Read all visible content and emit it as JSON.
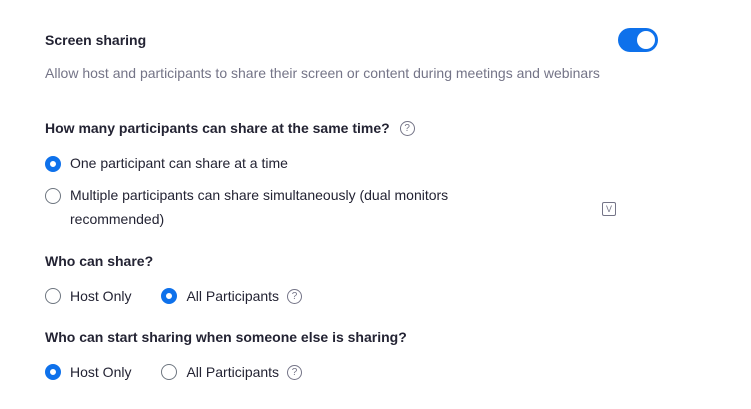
{
  "setting": {
    "title": "Screen sharing",
    "description": "Allow host and participants to share their screen or content during meetings and webinars",
    "enabled": true,
    "toggle_color": "#0e71eb"
  },
  "share_count": {
    "question": "How many participants can share at the same time?",
    "help_icon": "?",
    "options": [
      {
        "label": "One participant can share at a time",
        "checked": true
      },
      {
        "label": "Multiple participants can share simultaneously (dual monitors recommended)",
        "checked": false
      }
    ],
    "edit_icon": "V"
  },
  "who_can_share": {
    "question": "Who can share?",
    "options": [
      {
        "label": "Host Only",
        "checked": false
      },
      {
        "label": "All Participants",
        "checked": true
      }
    ],
    "help_icon": "?"
  },
  "who_can_start": {
    "question": "Who can start sharing when someone else is sharing?",
    "options": [
      {
        "label": "Host Only",
        "checked": true
      },
      {
        "label": "All Participants",
        "checked": false
      }
    ],
    "help_icon": "?"
  }
}
